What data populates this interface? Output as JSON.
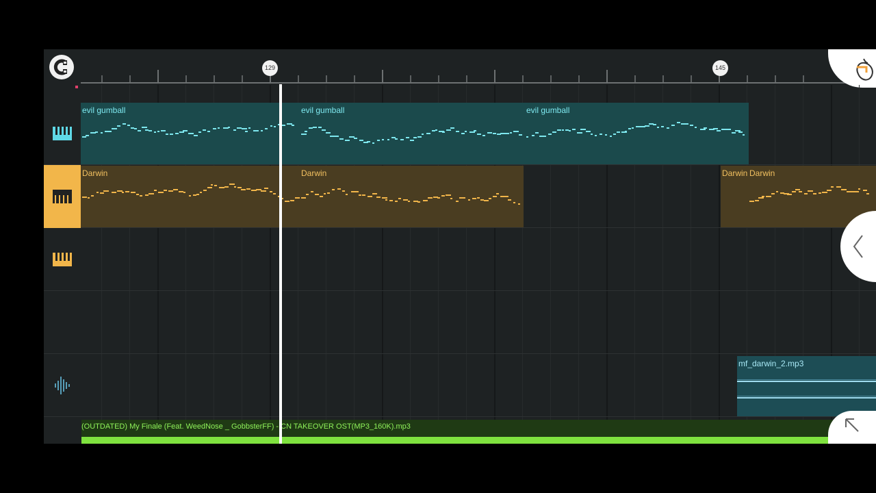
{
  "ruler": {
    "markers": [
      "129",
      "145"
    ]
  },
  "tracks": [
    {
      "icon": "piano-icon",
      "color": "#5fd8e6"
    },
    {
      "icon": "piano-icon",
      "color": "#222222"
    },
    {
      "icon": "piano-icon",
      "color": "#f2b64a"
    },
    {
      "icon": "waveform-icon",
      "color": "#6ac8ea"
    }
  ],
  "clips": {
    "row1": [
      "evil gumball",
      "evil gumball",
      "evil gumball"
    ],
    "row2": [
      "Darwin",
      "Darwin",
      "Darwin",
      "Darwin"
    ],
    "audio": "mf_darwin_2.mp3"
  },
  "bottom_track": {
    "name": "(OUTDATED) My Finale (Feat. WeedNose _ GobbsterFF) - CN TAKEOVER OST(MP3_160K).mp3",
    "color": "#7fe23f"
  },
  "colors": {
    "teal_clip": "#1b4a4c",
    "amber_clip": "#4a3d21",
    "active_track": "#f2b64a",
    "playhead": "#ffffff"
  }
}
